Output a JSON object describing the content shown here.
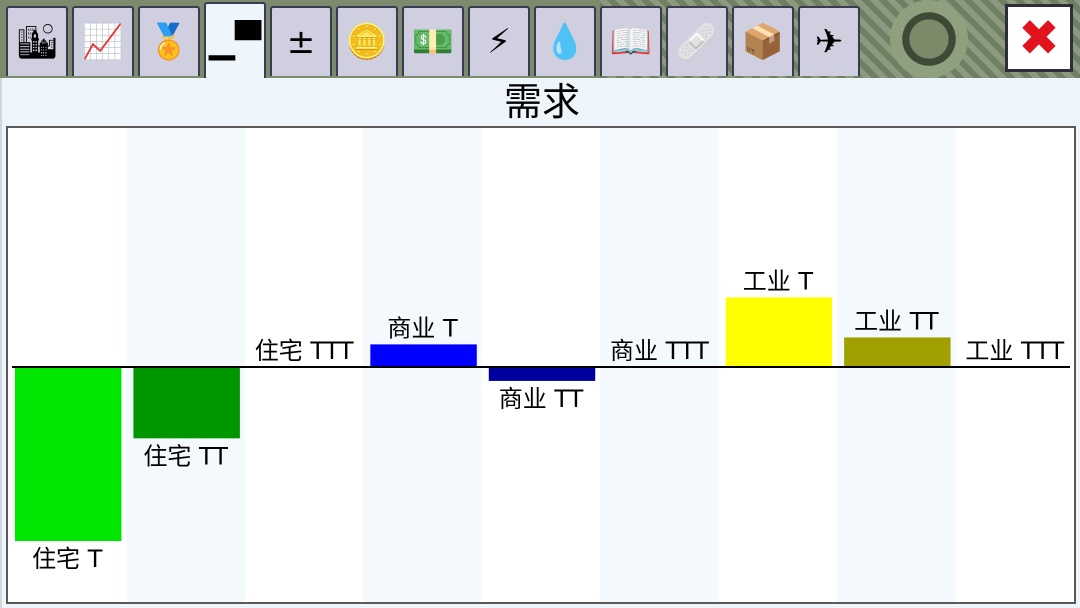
{
  "toolbar": {
    "tabs": [
      {
        "name": "city-tab",
        "icon": "city-buildings-icon",
        "glyph": "🏙"
      },
      {
        "name": "graphs-tab",
        "icon": "line-graph-icon",
        "glyph": "📈"
      },
      {
        "name": "awards-tab",
        "icon": "medal-icon",
        "glyph": "🏅"
      },
      {
        "name": "demand-tab",
        "icon": "demand-bars-icon",
        "glyph": "▁▀",
        "active": true
      },
      {
        "name": "budget-tab",
        "icon": "plus-minus-icon",
        "glyph": "±"
      },
      {
        "name": "money-tab",
        "icon": "coins-icon",
        "glyph": "🪙"
      },
      {
        "name": "cash-tab",
        "icon": "banknote-icon",
        "glyph": "💵"
      },
      {
        "name": "power-tab",
        "icon": "lightning-icon",
        "glyph": "⚡"
      },
      {
        "name": "water-tab",
        "icon": "water-drop-icon",
        "glyph": "💧"
      },
      {
        "name": "encyclopedia-tab",
        "icon": "book-az-icon",
        "glyph": "📖"
      },
      {
        "name": "health-tab",
        "icon": "medical-kit-icon",
        "glyph": "🩹"
      },
      {
        "name": "trade-tab",
        "icon": "trade-crates-icon",
        "glyph": "📦"
      },
      {
        "name": "airport-tab",
        "icon": "airplane-icon",
        "glyph": "✈"
      }
    ],
    "close_glyph": "✖"
  },
  "window": {
    "title": "需求"
  },
  "colors": {
    "res_low": "#00e600",
    "res_mid": "#009600",
    "res_high": "#004b00",
    "com_low": "#0000ff",
    "com_mid": "#0000a0",
    "com_high": "#000064",
    "ind_low": "#ffff00",
    "ind_mid": "#a0a000",
    "ind_high": "#646400",
    "stripe": "#f4f9fd",
    "axis": "#000000"
  },
  "chart_data": {
    "type": "bar",
    "title": "需求",
    "categories": [
      "住宅 T",
      "住宅 TT",
      "住宅 TTT",
      "商业 T",
      "商业 TT",
      "商业 TTT",
      "工业 T",
      "工业 TT",
      "工业 TTT"
    ],
    "values": [
      -100,
      -41,
      0,
      13,
      -8,
      0,
      40,
      17,
      0
    ],
    "ylim": [
      -100,
      100
    ],
    "xlabel": "",
    "ylabel": "",
    "grid": false,
    "legend": "none"
  }
}
